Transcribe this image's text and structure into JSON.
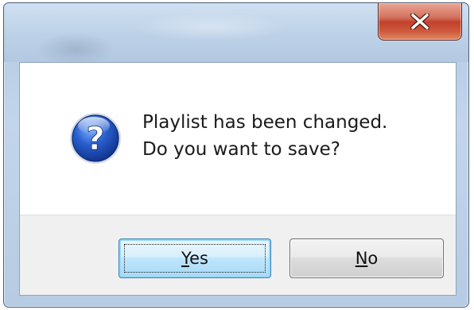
{
  "dialog": {
    "message_line1": "Playlist has been changed.",
    "message_line2": "Do you want to save?",
    "icon": "question-icon"
  },
  "titlebar": {
    "close_icon": "close-icon"
  },
  "buttons": {
    "yes": {
      "mnemonic": "Y",
      "rest": "es"
    },
    "no": {
      "mnemonic": "N",
      "rest": "o"
    }
  },
  "colors": {
    "close_button": "#c2412c",
    "default_button_border": "#3c7fb1",
    "button_bar": "#f0f0f0",
    "icon_blue": "#1f4fa8"
  }
}
